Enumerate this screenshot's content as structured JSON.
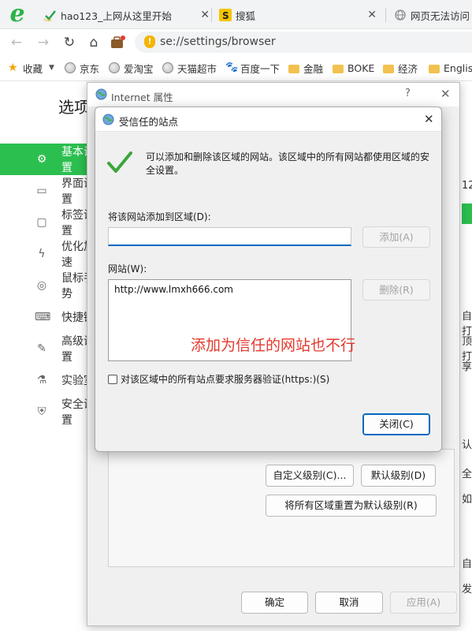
{
  "browser": {
    "tabs": [
      {
        "title": "hao123_上网从这里开始",
        "icon": "hao123-icon"
      },
      {
        "title": "搜狐",
        "icon": "sohu-icon"
      },
      {
        "title": "网页无法访问",
        "icon": "globe-icon"
      }
    ],
    "address": "se://settings/browser",
    "bookmarks": [
      "收藏",
      "京东",
      "爱淘宝",
      "天猫超市",
      "百度一下",
      "金融",
      "BOKE",
      "经济",
      "English"
    ]
  },
  "settings": {
    "title": "选项",
    "nav": [
      {
        "label": "基本设置",
        "icon": "gear-icon"
      },
      {
        "label": "界面设置",
        "icon": "window-icon"
      },
      {
        "label": "标签设置",
        "icon": "tab-icon"
      },
      {
        "label": "优化加速",
        "icon": "bolt-icon"
      },
      {
        "label": "鼠标手势",
        "icon": "mouse-icon"
      },
      {
        "label": "快捷键",
        "icon": "keyboard-icon"
      },
      {
        "label": "高级设置",
        "icon": "wrench-icon"
      },
      {
        "label": "实验室",
        "icon": "flask-icon"
      },
      {
        "label": "安全设置",
        "icon": "shield-icon"
      }
    ],
    "right_edge": [
      "12",
      "自打",
      "顶打",
      "享",
      "认",
      "全",
      "如",
      "自",
      "发"
    ]
  },
  "internet_options": {
    "title": "Internet 属性",
    "help": "?",
    "custom_level": "自定义级别(C)...",
    "default_level": "默认级别(D)",
    "reset_all": "将所有区域重置为默认级别(R)",
    "ok": "确定",
    "cancel": "取消",
    "apply": "应用(A)"
  },
  "trusted_sites": {
    "title": "受信任的站点",
    "info": "可以添加和删除该区域的网站。该区域中的所有网站都使用区域的安全设置。",
    "add_label": "将该网站添加到区域(D):",
    "add_value": "",
    "add_button": "添加(A)",
    "sites_label": "网站(W):",
    "sites": [
      "http://www.lmxh666.com"
    ],
    "remove_button": "删除(R)",
    "https_checkbox": "对该区域中的所有站点要求服务器验证(https:)(S)",
    "https_checked": false,
    "close_button": "关闭(C)"
  },
  "annotation": "添加为信任的网站也不行",
  "colors": {
    "accent": "#2bbf4f",
    "focus": "#0067c0",
    "annotation": "#e23a2e"
  }
}
